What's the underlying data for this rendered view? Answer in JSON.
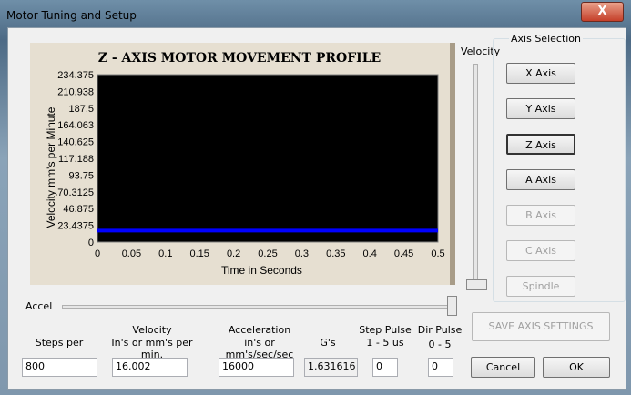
{
  "window": {
    "title": "Motor Tuning and Setup",
    "close": "X"
  },
  "chart_data": {
    "type": "line",
    "title": "Z - AXIS MOTOR MOVEMENT PROFILE",
    "xlabel": "Time in Seconds",
    "ylabel": "Velocity mm's per Minute",
    "xlim": [
      0,
      0.5
    ],
    "ylim": [
      0,
      234.375
    ],
    "x_ticks": [
      "0",
      "0.05",
      "0.1",
      "0.15",
      "0.2",
      "0.25",
      "0.3",
      "0.35",
      "0.4",
      "0.45",
      "0.5"
    ],
    "y_ticks": [
      "234.375",
      "210.938",
      "187.5",
      "164.063",
      "140.625",
      "117.188",
      "93.75",
      "70.3125",
      "46.875",
      "23.4375",
      "0"
    ],
    "series": [
      {
        "x": [
          0,
          0.5
        ],
        "y": [
          16.002,
          16.002
        ],
        "color": "#0000ff"
      }
    ],
    "background": "#000000"
  },
  "velocity_slider": {
    "label": "Velocity",
    "value": 0
  },
  "accel_slider": {
    "label": "Accel",
    "value": 1
  },
  "axis_selection": {
    "title": "Axis Selection",
    "buttons": [
      {
        "label": "X Axis",
        "enabled": true
      },
      {
        "label": "Y Axis",
        "enabled": true
      },
      {
        "label": "Z Axis",
        "enabled": true,
        "selected": true
      },
      {
        "label": "A Axis",
        "enabled": true
      },
      {
        "label": "B Axis",
        "enabled": false
      },
      {
        "label": "C Axis",
        "enabled": false
      },
      {
        "label": "Spindle",
        "enabled": false
      }
    ]
  },
  "fields": {
    "steps": {
      "label": "Steps per",
      "value": "800"
    },
    "velocity": {
      "label1": "Velocity",
      "label2": "In's or mm's per min.",
      "value": "16.002"
    },
    "accel": {
      "label1": "Acceleration",
      "label2": "in's or mm's/sec/sec",
      "value": "16000"
    },
    "gs": {
      "label": "G's",
      "value": "1.631616"
    },
    "step_pulse": {
      "label1": "Step Pulse",
      "label2": "1 - 5 us",
      "value": "0"
    },
    "dir_pulse": {
      "label1": "Dir Pulse",
      "label2": "0 - 5",
      "value": "0"
    }
  },
  "buttons": {
    "save": "SAVE AXIS SETTINGS",
    "cancel": "Cancel",
    "ok": "OK"
  }
}
